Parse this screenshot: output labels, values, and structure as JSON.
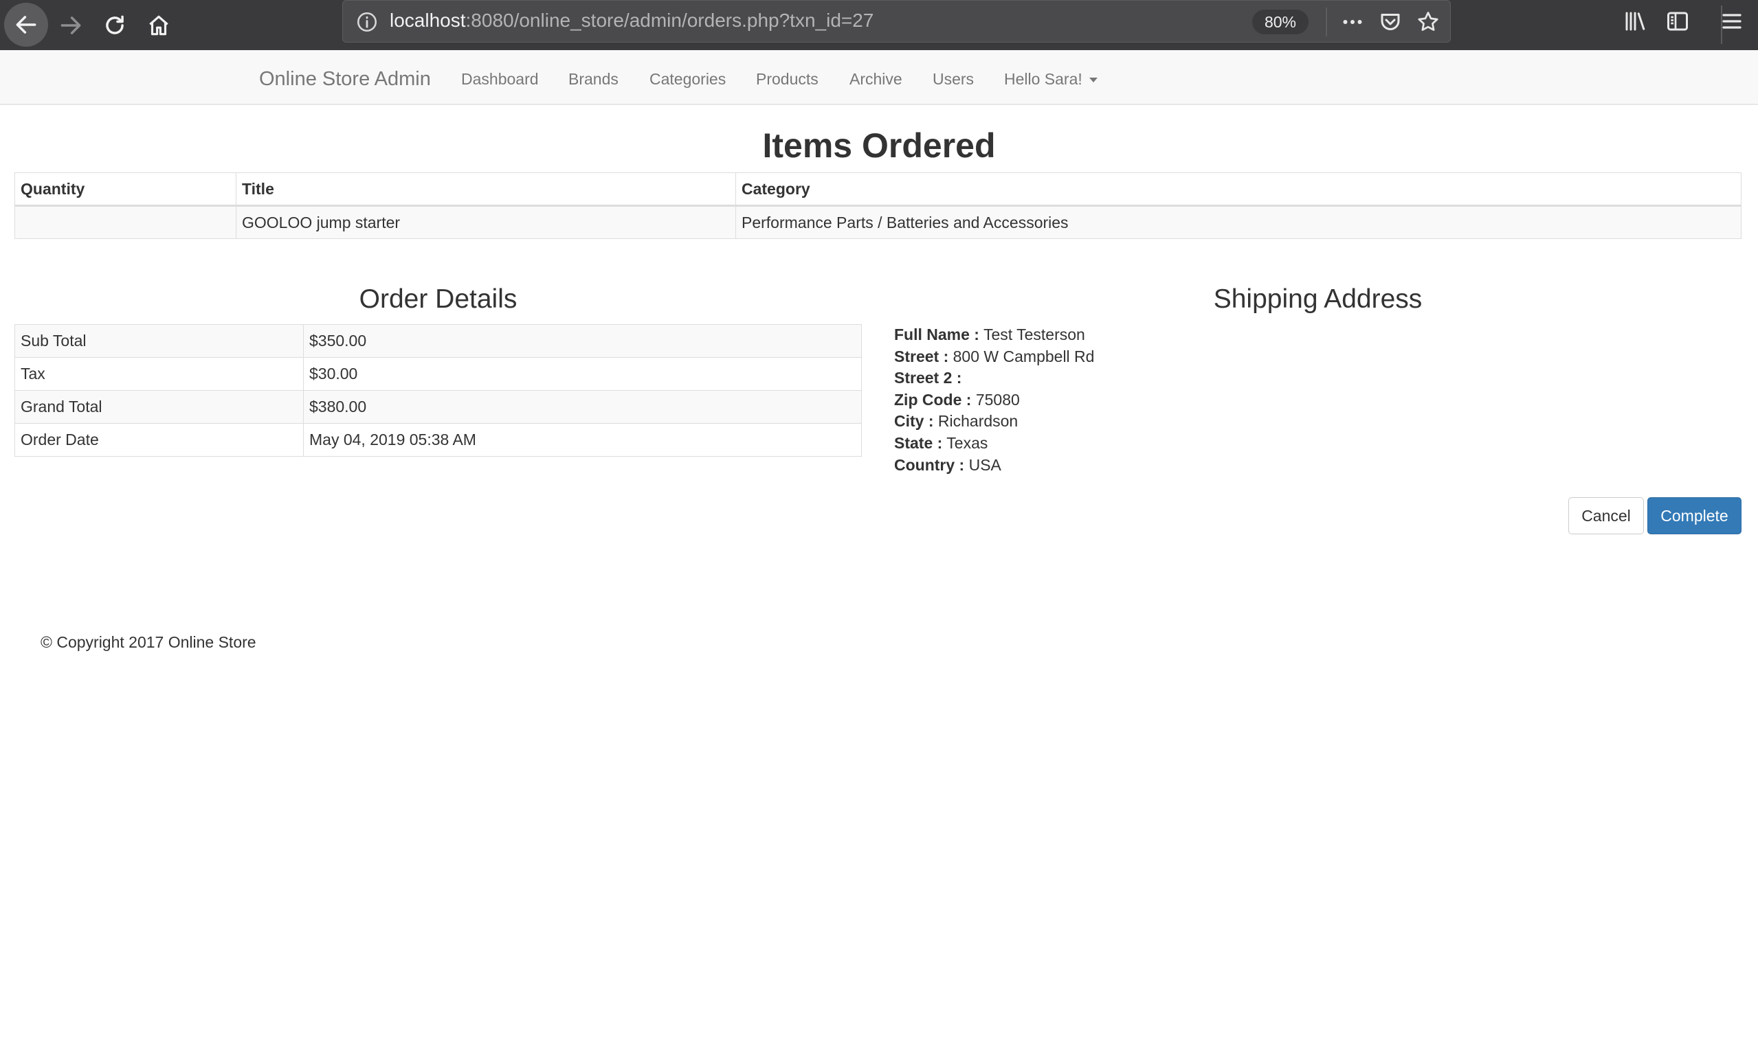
{
  "browser": {
    "url_host": "localhost",
    "url_rest": ":8080/online_store/admin/orders.php?txn_id=27",
    "zoom": "80%"
  },
  "navbar": {
    "brand": "Online Store Admin",
    "links": [
      "Dashboard",
      "Brands",
      "Categories",
      "Products",
      "Archive",
      "Users"
    ],
    "user_menu": "Hello Sara!"
  },
  "items_ordered": {
    "title": "Items Ordered",
    "headers": [
      "Quantity",
      "Title",
      "Category"
    ],
    "rows": [
      {
        "quantity": "",
        "title": "GOOLOO jump starter",
        "category": "Performance Parts / Batteries and Accessories"
      }
    ]
  },
  "order_details": {
    "title": "Order Details",
    "rows": [
      {
        "label": "Sub Total",
        "value": "$350.00"
      },
      {
        "label": "Tax",
        "value": "$30.00"
      },
      {
        "label": "Grand Total",
        "value": "$380.00"
      },
      {
        "label": "Order Date",
        "value": "May 04, 2019 05:38 AM"
      }
    ]
  },
  "shipping_address": {
    "title": "Shipping Address",
    "fields": [
      {
        "label": "Full Name :",
        "value": "Test Testerson"
      },
      {
        "label": "Street :",
        "value": "800 W Campbell Rd"
      },
      {
        "label": "Street 2 :",
        "value": ""
      },
      {
        "label": "Zip Code :",
        "value": "75080"
      },
      {
        "label": "City :",
        "value": "Richardson"
      },
      {
        "label": "State :",
        "value": "Texas"
      },
      {
        "label": "Country :",
        "value": "USA"
      }
    ]
  },
  "actions": {
    "cancel_label": "Cancel",
    "complete_label": "Complete"
  },
  "footer": {
    "copyright": "© Copyright 2017 Online Store"
  },
  "colors": {
    "primary_button": "#337ab7",
    "chrome_bg": "#3a3a3c",
    "navbar_bg": "#f8f8f8"
  }
}
